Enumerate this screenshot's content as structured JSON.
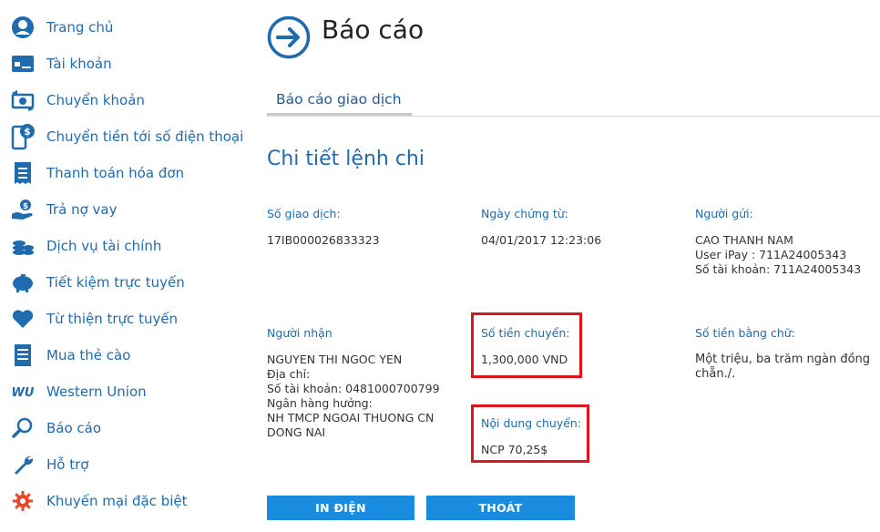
{
  "colors": {
    "accent": "#1e6bb0",
    "button": "#1a8ce0",
    "highlight": "#e0151c"
  },
  "sidebar": {
    "items": [
      {
        "label": "Trang chủ",
        "icon": "user-avatar-icon"
      },
      {
        "label": "Tài khoản",
        "icon": "card-icon"
      },
      {
        "label": "Chuyển khoản",
        "icon": "money-transfer-icon"
      },
      {
        "label": "Chuyển tiền tới số điện thoại",
        "icon": "phone-dollar-icon"
      },
      {
        "label": "Thanh toán hóa đơn",
        "icon": "bill-icon"
      },
      {
        "label": "Trả nợ vay",
        "icon": "hand-money-icon"
      },
      {
        "label": "Dịch vụ tài chính",
        "icon": "coins-icon"
      },
      {
        "label": "Tiết kiệm trực tuyến",
        "icon": "piggy-bank-icon"
      },
      {
        "label": "Từ thiện trực tuyến",
        "icon": "heart-icon"
      },
      {
        "label": "Mua thẻ cào",
        "icon": "scratch-card-icon"
      },
      {
        "label": "Western Union",
        "icon": "western-union-icon"
      },
      {
        "label": "Báo cáo",
        "icon": "search-icon"
      },
      {
        "label": "Hỗ trợ",
        "icon": "wrench-icon"
      },
      {
        "label": "Khuyến mại đặc biệt",
        "icon": "gear-badge-icon"
      }
    ]
  },
  "header": {
    "title": "Báo cáo",
    "icon": "arrow-right-circle-icon"
  },
  "tabs": [
    {
      "label": "Báo cáo giao dịch"
    }
  ],
  "section_title": "Chi tiết lệnh chi",
  "details": {
    "transaction_no_label": "Số giao dịch:",
    "transaction_no": "17IB000026833323",
    "date_label": "Ngày chứng từ:",
    "date": "04/01/2017 12:23:06",
    "sender_label": "Người gửi:",
    "sender_lines": [
      "CAO THANH NAM",
      "User iPay : 711A24005343",
      "Số tài khoản: 711A24005343"
    ],
    "recipient_label": "Người nhận",
    "recipient_lines": [
      "NGUYEN THI NGOC YEN",
      "Địa chỉ:",
      "Số tài khoản: 0481000700799",
      "Ngân hàng hưởng:",
      "NH TMCP NGOAI THUONG CN",
      "DONG NAI"
    ],
    "amount_label": "Số tiền chuyển:",
    "amount": "1,300,000 VND",
    "amount_words_label": "Số tiền bằng chữ:",
    "amount_words_lines": [
      "Một triệu, ba trăm ngàn đồng",
      "chẵn./."
    ],
    "content_label": "Nội dung chuyển:",
    "content": "NCP 70,25$"
  },
  "buttons": {
    "print": "IN ĐIỆN",
    "exit": "THOÁT"
  }
}
